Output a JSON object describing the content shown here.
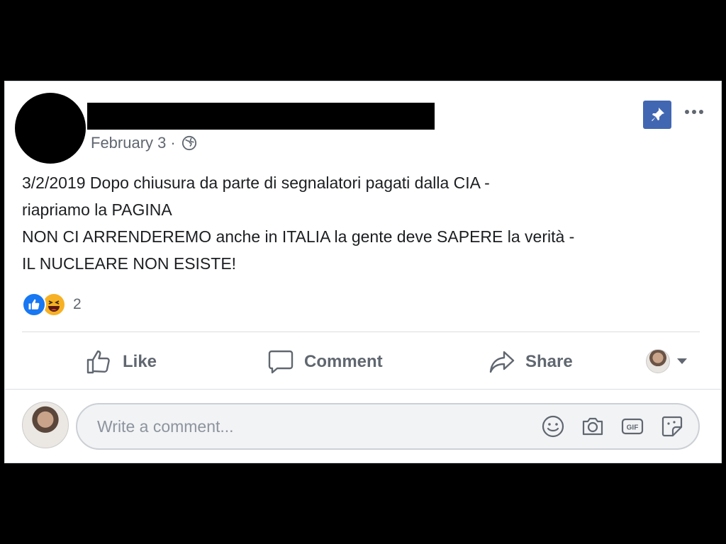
{
  "post": {
    "date": "February 3",
    "separator": "·",
    "text_lines": [
      "3/2/2019 Dopo chiusura da parte di segnalatori pagati dalla CIA -",
      "riapriamo la PAGINA",
      "NON CI ARRENDEREMO anche in ITALIA la gente deve SAPERE la verità -",
      "IL NUCLEARE NON ESISTE!"
    ],
    "reaction_count": "2"
  },
  "actions": {
    "like": "Like",
    "comment": "Comment",
    "share": "Share"
  },
  "comment_box": {
    "placeholder": "Write a comment..."
  },
  "colors": {
    "accent": "#4267b2",
    "like_blue": "#1877f2",
    "haha_yellow": "#f7b125",
    "muted_text": "#606770"
  },
  "icons": {
    "pin": "pin-icon",
    "more": "more-options-icon",
    "globe": "globe-icon",
    "like": "thumbs-up-icon",
    "comment": "comment-bubble-icon",
    "share": "share-arrow-icon",
    "emoji": "emoji-icon",
    "camera": "camera-icon",
    "gif": "gif-icon",
    "sticker": "sticker-icon"
  }
}
